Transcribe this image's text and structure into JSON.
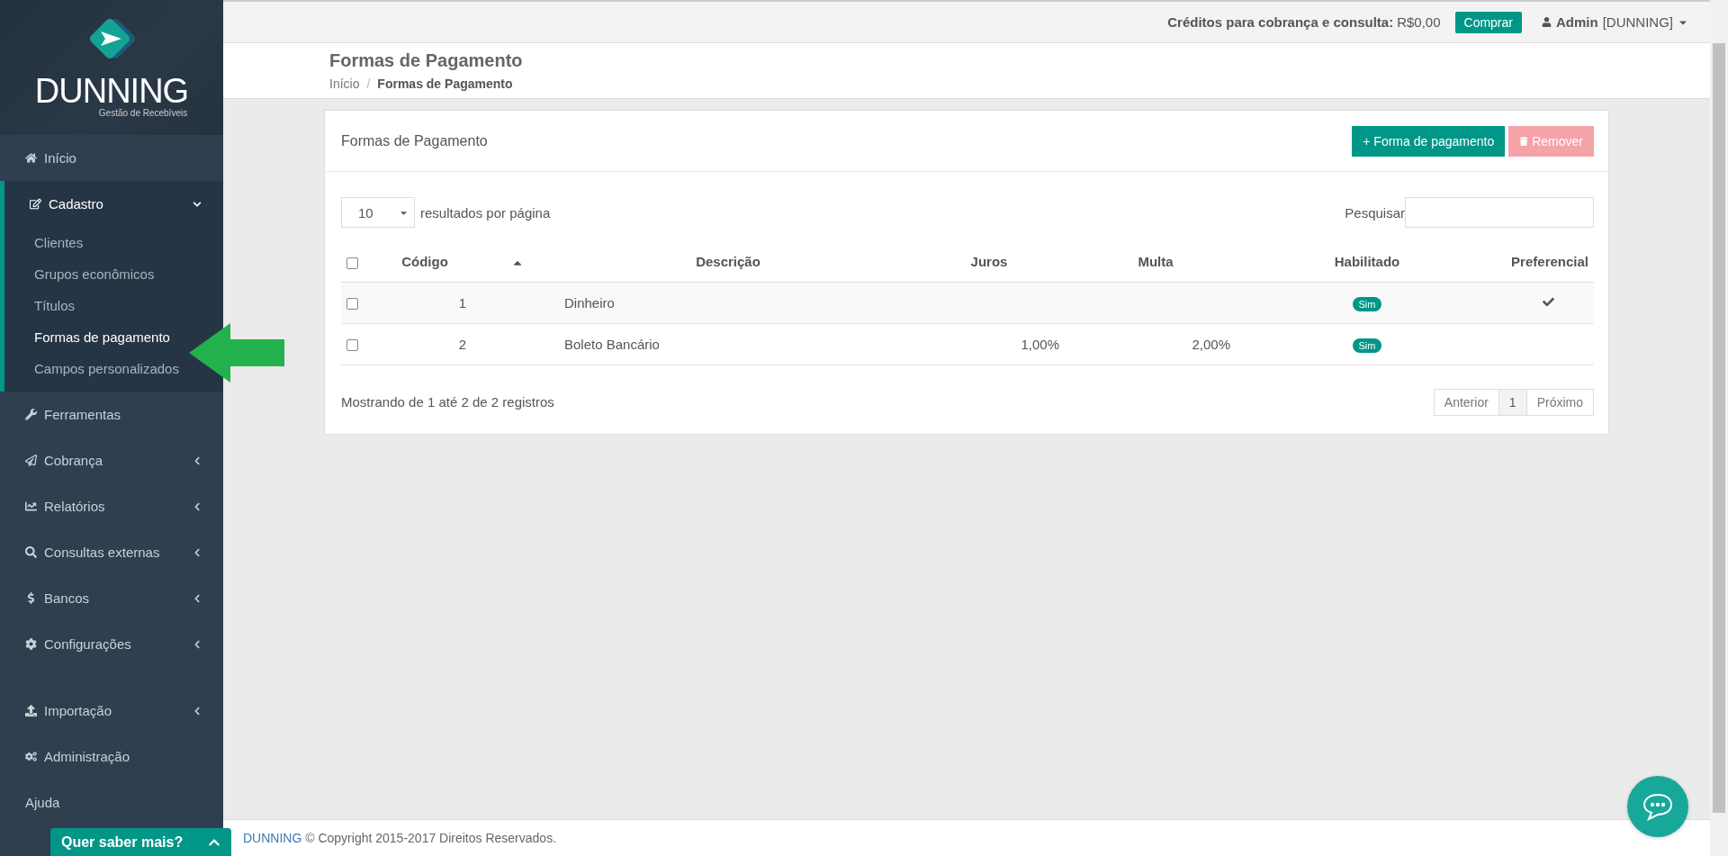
{
  "sidebar": {
    "logo": {
      "name": "DUNNING",
      "tagline": "Gestão de Recebíveis"
    },
    "menu": [
      {
        "label": "Início",
        "selected": false
      },
      {
        "label": "Cadastro",
        "selected": true,
        "expanded": true,
        "children": [
          {
            "label": "Clientes",
            "selected": false
          },
          {
            "label": "Grupos econômicos",
            "selected": false
          },
          {
            "label": "Títulos",
            "selected": false
          },
          {
            "label": "Formas de pagamento",
            "selected": true
          },
          {
            "label": "Campos personalizados",
            "selected": false
          }
        ]
      },
      {
        "label": "Ferramentas",
        "selected": false
      },
      {
        "label": "Cobrança",
        "selected": false,
        "expanded": false
      },
      {
        "label": "Relatórios",
        "selected": false,
        "expanded": false
      },
      {
        "label": "Consultas externas",
        "selected": false,
        "expanded": false
      },
      {
        "label": "Bancos",
        "selected": false,
        "expanded": false
      },
      {
        "label": "Configurações",
        "selected": false,
        "expanded": false
      }
    ],
    "menu_bottom": [
      {
        "label": "Importação",
        "selected": false,
        "expanded": false
      },
      {
        "label": "Administração",
        "selected": false
      },
      {
        "label": "Ajuda",
        "selected": false
      }
    ]
  },
  "top_bar": {
    "credits_label": "Créditos para cobrança e consulta:",
    "credits_value": "R$0,00",
    "buy_button": "Comprar",
    "user": "Admin",
    "account": "[DUNNING]"
  },
  "page_header": {
    "title": "Formas de Pagamento",
    "separator": "/",
    "breadcrumb": [
      {
        "label": "Início",
        "current": false
      },
      {
        "label": "Formas de Pagamento",
        "current": true
      }
    ]
  },
  "panel": {
    "title": "Formas de Pagamento",
    "add_button": "+ Forma de pagamento",
    "remove_button": {
      "label": "Remover",
      "disabled": true
    },
    "page_size": "10",
    "page_size_label": "resultados por página",
    "search_label": "Pesquisar",
    "table": {
      "select_all": false,
      "columns": [
        {
          "label": "Código",
          "sorted": true
        },
        {
          "label": "Descrição",
          "sorted": false
        },
        {
          "label": "Juros",
          "sorted": false
        },
        {
          "label": "Multa",
          "sorted": false
        },
        {
          "label": "Habilitado",
          "sorted": false
        },
        {
          "label": "Preferencial",
          "sorted": false
        }
      ],
      "rows": [
        {
          "checked": false,
          "code": "1",
          "description": "Dinheiro",
          "enabled": "Sim",
          "preferred": true
        },
        {
          "checked": false,
          "code": "2",
          "description": "Boleto Bancário",
          "interest": "1,00%",
          "fine": "2,00%",
          "enabled": "Sim",
          "preferred": false
        }
      ]
    },
    "info": "Mostrando de 1 até 2 de 2 registros",
    "pagination": [
      {
        "label": "Anterior",
        "kind": "nav",
        "selected": false
      },
      {
        "label": "1",
        "kind": "page",
        "selected": true
      },
      {
        "label": "Próximo",
        "kind": "nav",
        "selected": false
      }
    ]
  },
  "footer": {
    "brand": "DUNNING",
    "text": "© Copyright 2015-2017 Direitos Reservados."
  },
  "chat_widget": {
    "label": "Quer saber mais?"
  }
}
